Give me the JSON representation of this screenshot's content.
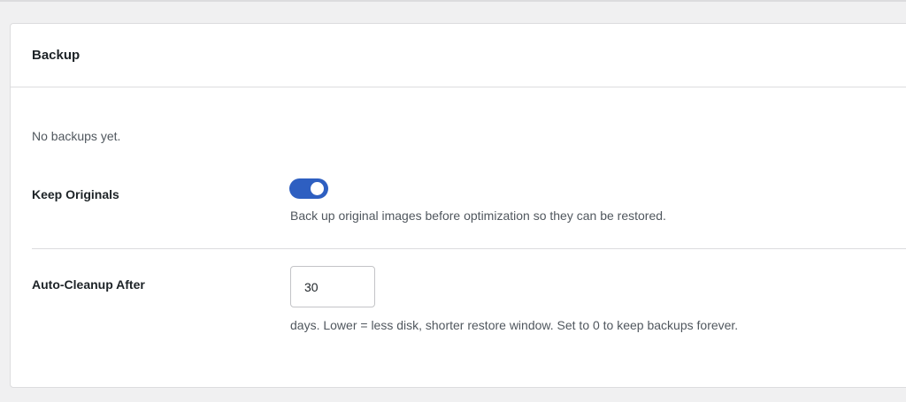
{
  "backup": {
    "title": "Backup",
    "empty_message": "No backups yet.",
    "keep_originals": {
      "label": "Keep Originals",
      "enabled": true,
      "help": "Back up original images before optimization so they can be restored."
    },
    "auto_cleanup": {
      "label": "Auto-Cleanup After",
      "value": "30",
      "help": "days. Lower = less disk, shorter restore window. Set to 0 to keep backups forever."
    }
  },
  "colors": {
    "toggle_on": "#2e5fc1",
    "page_bg": "#f0f0f1",
    "panel_bg": "#ffffff",
    "border": "#dcdcde"
  }
}
